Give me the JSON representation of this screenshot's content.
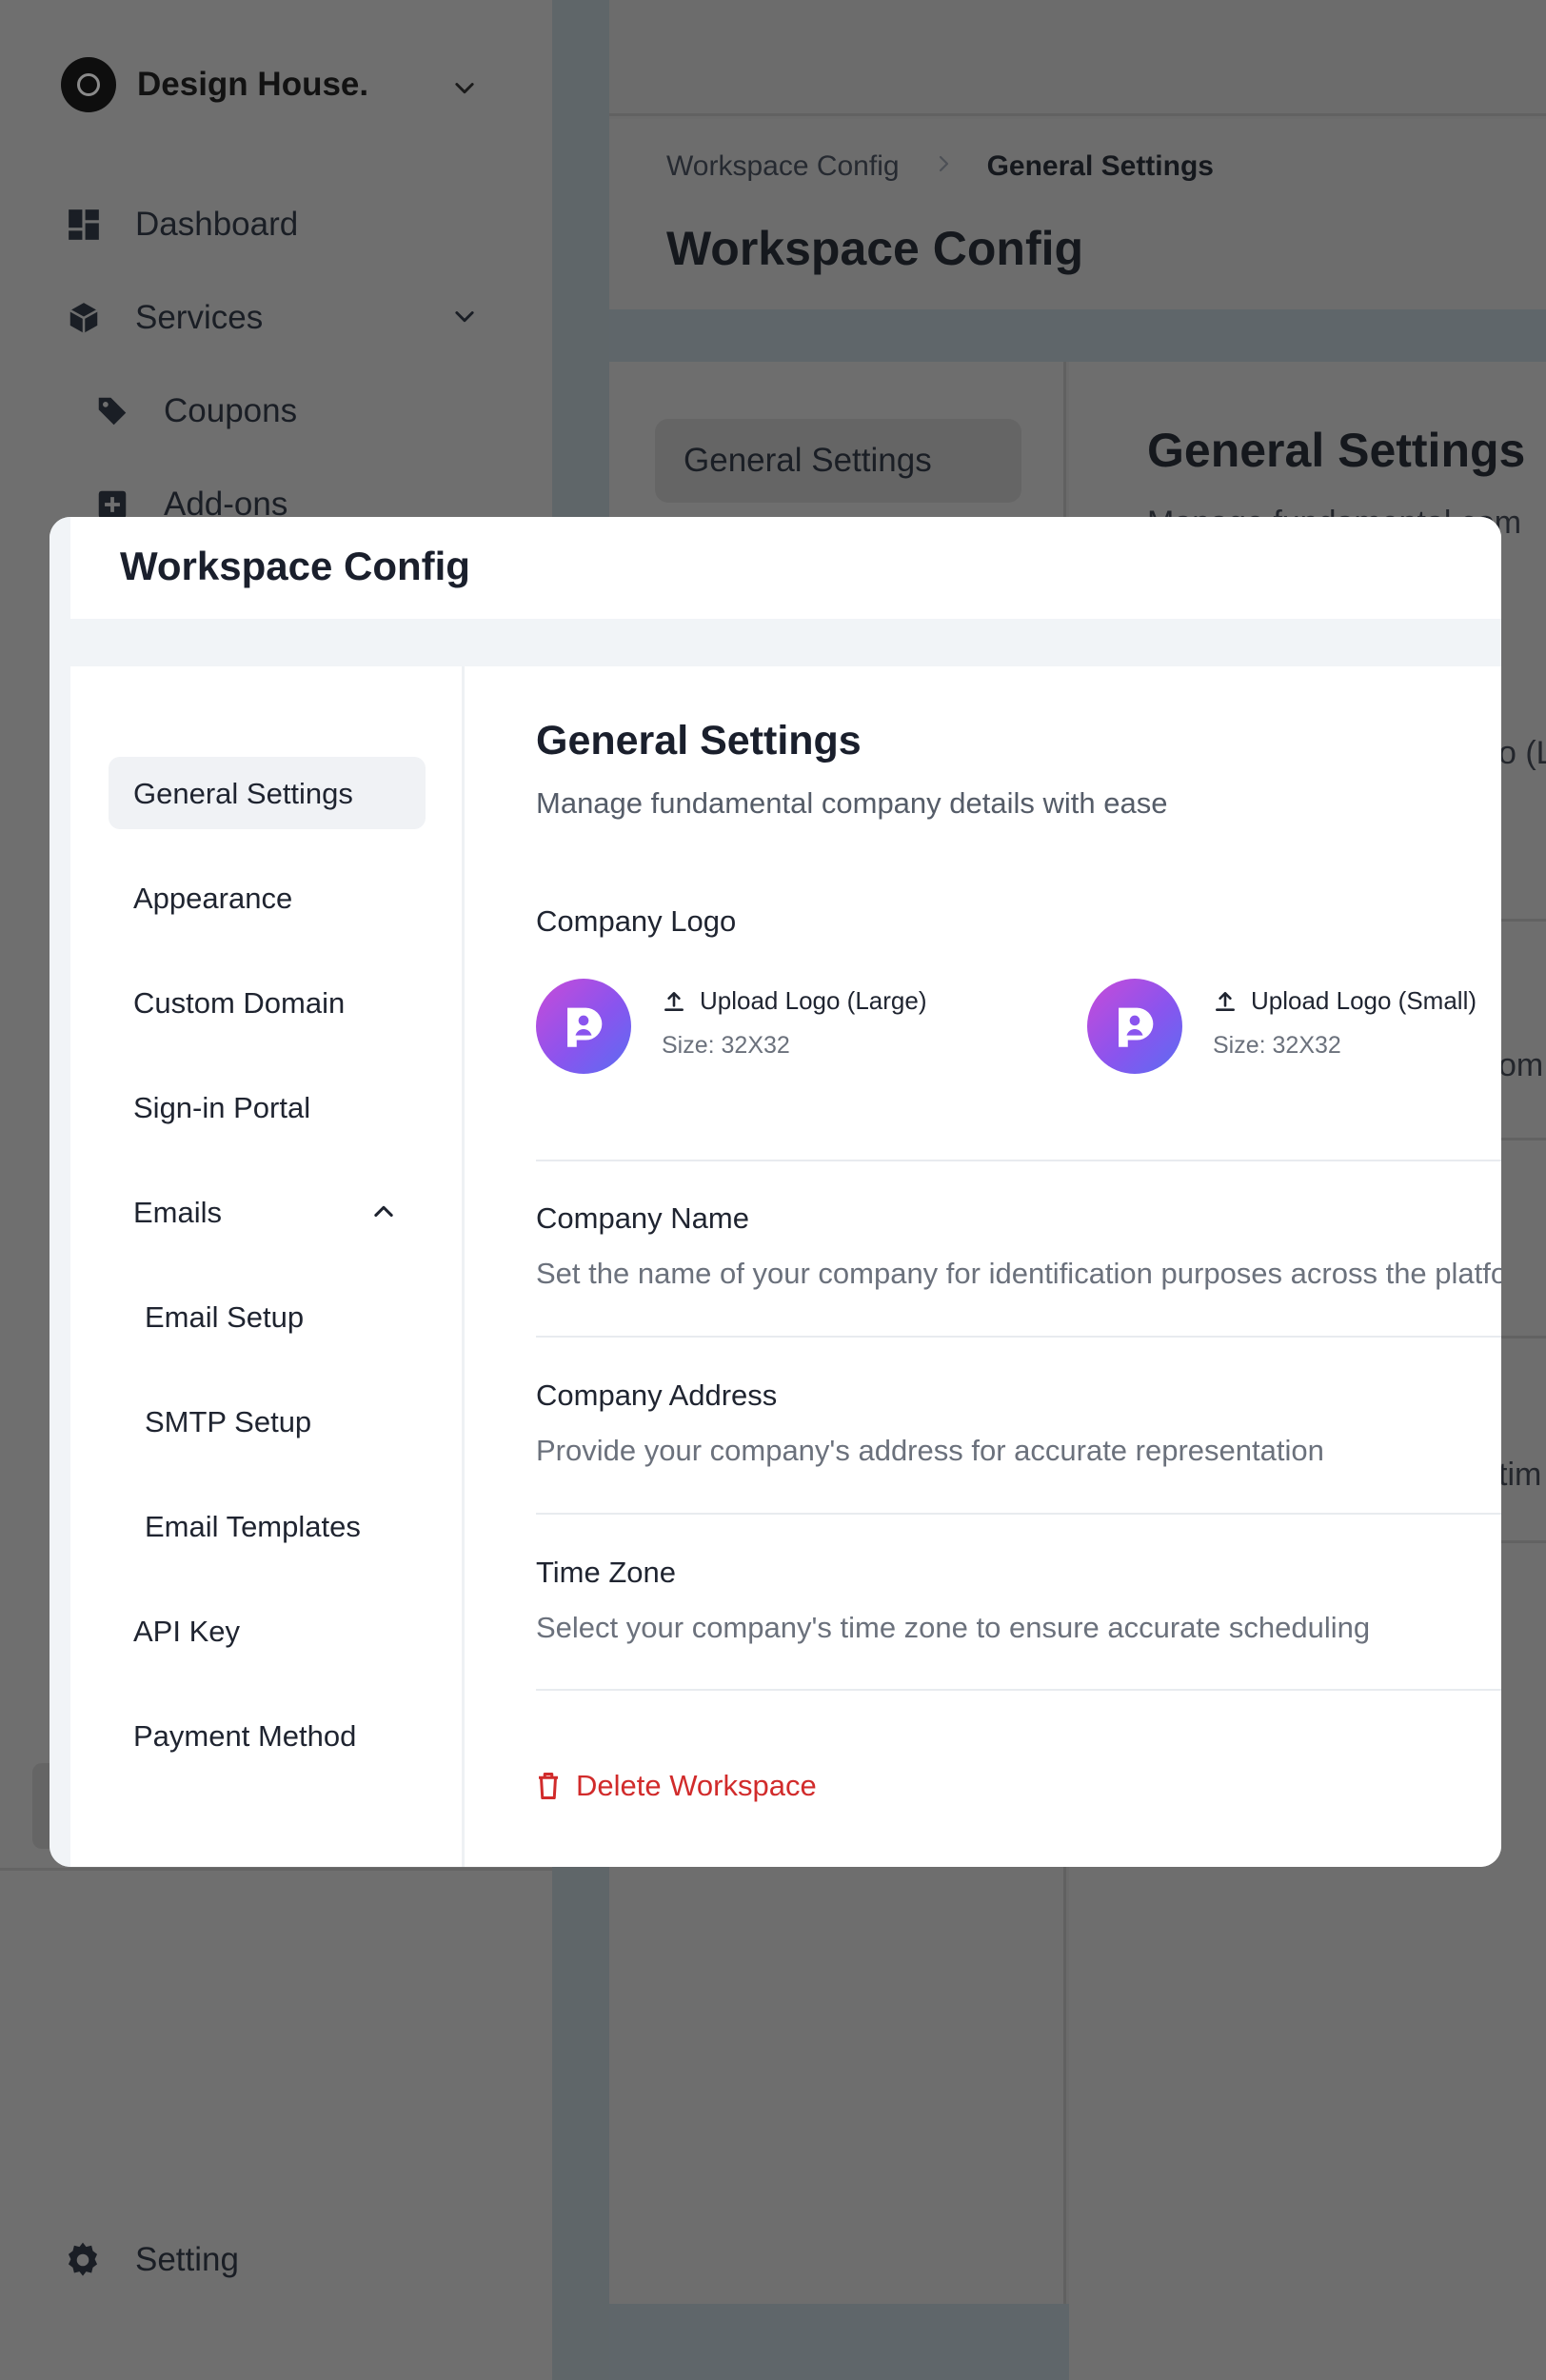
{
  "sidebar": {
    "brand_name": "Design House.",
    "items": [
      {
        "label": "Dashboard"
      },
      {
        "label": "Services"
      },
      {
        "label": "Coupons"
      },
      {
        "label": "Add-ons"
      }
    ],
    "setting_label": "Setting"
  },
  "header": {
    "breadcrumb": [
      "Workspace Config",
      "General Settings"
    ],
    "title": "Workspace Config"
  },
  "background_page": {
    "subnav_active": "General Settings",
    "content_title": "General Settings",
    "content_sub_fragment": "Manage fundamental com",
    "fragment_logo_large": "o (La",
    "fragment_name_desc": "om",
    "fragment_timezone": "tim"
  },
  "modal": {
    "title": "Workspace Config",
    "nav": {
      "general_settings": "General Settings",
      "appearance": "Appearance",
      "custom_domain": "Custom Domain",
      "signin_portal": "Sign-in Portal",
      "emails": "Emails",
      "email_setup": "Email Setup",
      "smtp_setup": "SMTP Setup",
      "email_templates": "Email Templates",
      "api_key": "API Key",
      "payment_method": "Payment Method"
    },
    "main": {
      "title": "General Settings",
      "subtitle": "Manage fundamental company details with ease",
      "company_logo": {
        "label": "Company Logo",
        "large_button": "Upload Logo (Large)",
        "large_size": "Size: 32X32",
        "small_button": "Upload Logo (Small)",
        "small_size": "Size: 32X32"
      },
      "company_name": {
        "label": "Company Name",
        "desc": "Set the name of your company for identification purposes across the platform"
      },
      "company_address": {
        "label": "Company Address",
        "desc": "Provide your company's address for accurate representation"
      },
      "time_zone": {
        "label": "Time Zone",
        "desc": "Select your company's time zone to ensure accurate scheduling"
      },
      "delete_label": "Delete Workspace"
    }
  },
  "colors": {
    "danger": "#d12b2b",
    "logo_gradient_start": "#c84bd8",
    "logo_gradient_end": "#5b6df2",
    "overlay": "#6b6b6b"
  }
}
